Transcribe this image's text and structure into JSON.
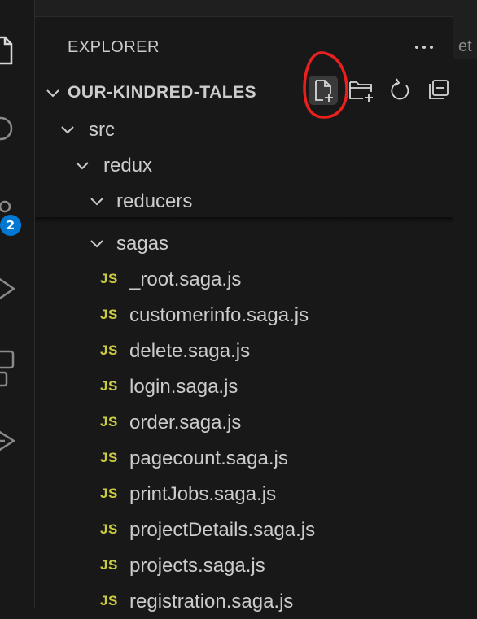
{
  "activity_bar": {
    "badge_count": "2",
    "icons": [
      "files-icon",
      "search-icon",
      "source-control-icon",
      "run-debug-icon",
      "extensions-icon",
      "remote-icon"
    ]
  },
  "tab": {
    "partial_label": "et"
  },
  "explorer": {
    "title": "EXPLORER",
    "more_label": "···",
    "project": {
      "name": "OUR-KINDRED-TALES",
      "tools": [
        "new-file-icon",
        "new-folder-icon",
        "refresh-icon",
        "collapse-all-icon"
      ]
    },
    "tree": {
      "src": "src",
      "redux": "redux",
      "reducers": "reducers",
      "sagas": "sagas"
    },
    "file_badge": "JS",
    "files": [
      "_root.saga.js",
      "customerinfo.saga.js",
      "delete.saga.js",
      "login.saga.js",
      "order.saga.js",
      "pagecount.saga.js",
      "printJobs.saga.js",
      "projectDetails.saga.js",
      "projects.saga.js",
      "registration.saga.js"
    ]
  },
  "colors": {
    "background": "#181818",
    "text": "#cccccc",
    "js_badge": "#cbcb41",
    "badge": "#0078d4",
    "annotation": "#e8211e"
  }
}
